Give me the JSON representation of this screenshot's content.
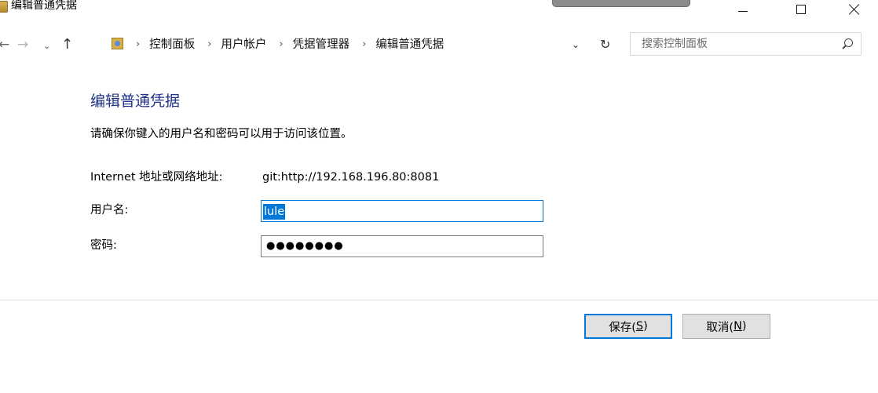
{
  "window": {
    "title": "编辑普通凭据"
  },
  "nav": {
    "back_glyph": "←",
    "forward_glyph": "→",
    "recent_glyph": "⌄",
    "up_glyph": "↑",
    "breadcrumbs": [
      "控制面板",
      "用户帐户",
      "凭据管理器",
      "编辑普通凭据"
    ],
    "separator": "›",
    "dropdown_glyph": "⌄",
    "refresh_glyph": "↻",
    "search_placeholder": "搜索控制面板"
  },
  "content": {
    "heading": "编辑普通凭据",
    "instruction": "请确保你键入的用户名和密码可以用于访问该位置。",
    "address_label": "Internet 地址或网络地址:",
    "address_value": "git:http://192.168.196.80:8081",
    "username_label": "用户名:",
    "username_value": "lule",
    "password_label": "密码:",
    "password_mask": "●●●●●●●●"
  },
  "buttons": {
    "save_label": "保存(",
    "save_key": "S",
    "save_tail": ")",
    "cancel_label": "取消(",
    "cancel_key": "N",
    "cancel_tail": ")"
  },
  "icons": {
    "app": "credential-manager-icon",
    "control_panel": "control-panel-icon",
    "search": "search-icon",
    "minimize": "minimize-icon",
    "maximize": "maximize-icon",
    "close": "close-icon"
  },
  "colors": {
    "heading": "#1e3287",
    "accent": "#0078d7",
    "button_face": "#e1e1e1"
  }
}
